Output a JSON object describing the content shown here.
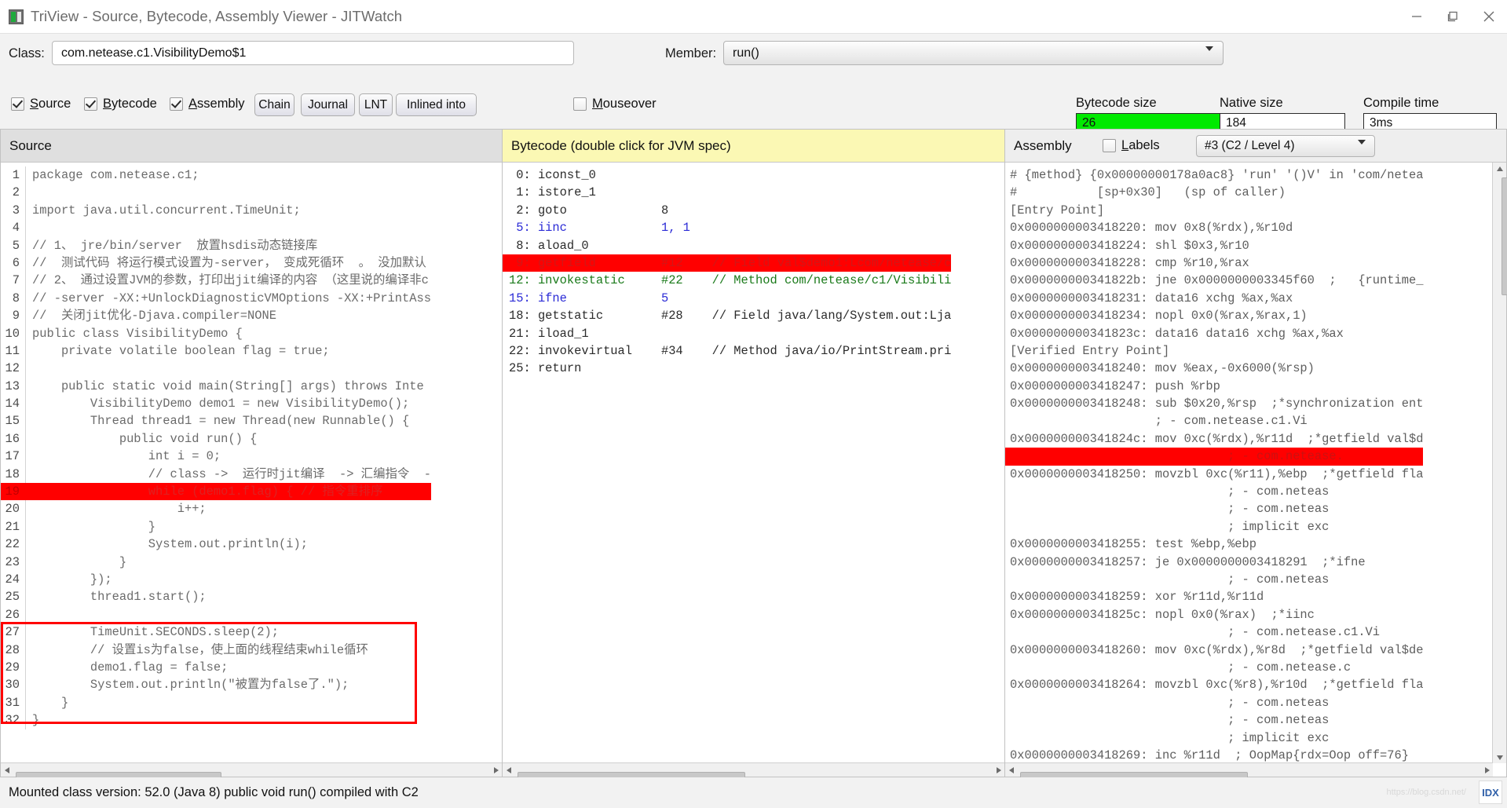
{
  "window": {
    "title": "TriView - Source, Bytecode, Assembly Viewer - JITWatch",
    "icon": "app-icon",
    "minimize_label": "–",
    "maximize_label": "❐",
    "close_label": "✕"
  },
  "toolbar": {
    "class_label": "Class:",
    "class_value": "com.netease.c1.VisibilityDemo$1",
    "member_label": "Member:",
    "member_value": "run()",
    "checkboxes": [
      {
        "label": "Source",
        "mnemonic": "S",
        "rest": "ource",
        "checked": true
      },
      {
        "label": "Bytecode",
        "mnemonic": "B",
        "rest": "ytecode",
        "checked": true
      },
      {
        "label": "Assembly",
        "mnemonic": "A",
        "rest": "ssembly",
        "checked": true
      },
      {
        "label": "Mouseover",
        "mnemonic": "M",
        "rest": "ouseover",
        "checked": false
      }
    ],
    "buttons": [
      "Chain",
      "Journal",
      "LNT",
      "Inlined into"
    ]
  },
  "metrics": [
    {
      "label": "Bytecode size",
      "value": "26",
      "highlight": "#00ea00"
    },
    {
      "label": "Native size",
      "value": "184",
      "highlight": ""
    },
    {
      "label": "Compile time",
      "value": "3ms",
      "highlight": ""
    }
  ],
  "source_panel": {
    "title": "Source",
    "lines": [
      {
        "n": "1",
        "text": "package com.netease.c1;",
        "hl": false
      },
      {
        "n": "2",
        "text": "",
        "hl": false
      },
      {
        "n": "3",
        "text": "import java.util.concurrent.TimeUnit;",
        "hl": false
      },
      {
        "n": "4",
        "text": "",
        "hl": false
      },
      {
        "n": "5",
        "text": "// 1、 jre/bin/server  放置hsdis动态链接库",
        "hl": false
      },
      {
        "n": "6",
        "text": "//  测试代码 将运行模式设置为-server， 变成死循环  。 没加默认",
        "hl": false
      },
      {
        "n": "7",
        "text": "// 2、 通过设置JVM的参数，打印出jit编译的内容 （这里说的编译非c",
        "hl": false
      },
      {
        "n": "8",
        "text": "// -server -XX:+UnlockDiagnosticVMOptions -XX:+PrintAss",
        "hl": false
      },
      {
        "n": "9",
        "text": "//  关闭jit优化-Djava.compiler=NONE",
        "hl": false
      },
      {
        "n": "10",
        "text": "public class VisibilityDemo {",
        "hl": false
      },
      {
        "n": "11",
        "text": "    private volatile boolean flag = true;",
        "hl": false
      },
      {
        "n": "12",
        "text": "",
        "hl": false
      },
      {
        "n": "13",
        "text": "    public static void main(String[] args) throws Inte",
        "hl": false
      },
      {
        "n": "14",
        "text": "        VisibilityDemo demo1 = new VisibilityDemo();",
        "hl": false
      },
      {
        "n": "15",
        "text": "        Thread thread1 = new Thread(new Runnable() {",
        "hl": false
      },
      {
        "n": "16",
        "text": "            public void run() {",
        "hl": false
      },
      {
        "n": "17",
        "text": "                int i = 0;",
        "hl": false
      },
      {
        "n": "18",
        "text": "                // class ->  运行时jit编译  -> 汇编指令  -",
        "hl": false
      },
      {
        "n": "19",
        "text": "                while (demo1.flag) { // 指令重排序",
        "hl": true
      },
      {
        "n": "20",
        "text": "                    i++;",
        "hl": false
      },
      {
        "n": "21",
        "text": "                }",
        "hl": false
      },
      {
        "n": "22",
        "text": "                System.out.println(i);",
        "hl": false
      },
      {
        "n": "23",
        "text": "            }",
        "hl": false
      },
      {
        "n": "24",
        "text": "        });",
        "hl": false
      },
      {
        "n": "25",
        "text": "        thread1.start();",
        "hl": false
      },
      {
        "n": "26",
        "text": "",
        "hl": false
      },
      {
        "n": "27",
        "text": "        TimeUnit.SECONDS.sleep(2);",
        "hl": false
      },
      {
        "n": "28",
        "text": "        // 设置is为false，使上面的线程结束while循环",
        "hl": false
      },
      {
        "n": "29",
        "text": "        demo1.flag = false;",
        "hl": false
      },
      {
        "n": "30",
        "text": "        System.out.println(\"被置为false了.\");",
        "hl": false
      },
      {
        "n": "31",
        "text": "    }",
        "hl": false
      },
      {
        "n": "32",
        "text": "}",
        "hl": false
      }
    ]
  },
  "bytecode_panel": {
    "title": "Bytecode (double click for JVM spec)",
    "lines": [
      {
        "offset": "0:",
        "op": "iconst_0",
        "arg": "",
        "comment": "",
        "color": "black",
        "hl": false
      },
      {
        "offset": "1:",
        "op": "istore_1",
        "arg": "",
        "comment": "",
        "color": "black",
        "hl": false
      },
      {
        "offset": "2:",
        "op": "goto",
        "arg": "8",
        "comment": "",
        "color": "black",
        "hl": false
      },
      {
        "offset": "5:",
        "op": "iinc",
        "arg": "1, 1",
        "comment": "",
        "color": "blue",
        "hl": false
      },
      {
        "offset": "8:",
        "op": "aload_0",
        "arg": "",
        "comment": "",
        "color": "black",
        "hl": false
      },
      {
        "offset": "9:",
        "op": "getfield",
        "arg": "#12",
        "comment": "// Field val$demo1:Lcom/netease/c",
        "color": "hl",
        "hl": true
      },
      {
        "offset": "12:",
        "op": "invokestatic",
        "arg": "#22",
        "comment": "// Method com/netease/c1/Visibili",
        "color": "green",
        "hl": false
      },
      {
        "offset": "15:",
        "op": "ifne",
        "arg": "5",
        "comment": "",
        "color": "blue",
        "hl": false
      },
      {
        "offset": "18:",
        "op": "getstatic",
        "arg": "#28",
        "comment": "// Field java/lang/System.out:Lja",
        "color": "black",
        "hl": false
      },
      {
        "offset": "21:",
        "op": "iload_1",
        "arg": "",
        "comment": "",
        "color": "black",
        "hl": false
      },
      {
        "offset": "22:",
        "op": "invokevirtual",
        "arg": "#34",
        "comment": "// Method java/io/PrintStream.pri",
        "color": "black",
        "hl": false
      },
      {
        "offset": "25:",
        "op": "return",
        "arg": "",
        "comment": "",
        "color": "black",
        "hl": false
      }
    ]
  },
  "assembly_panel": {
    "title": "Assembly",
    "labels_checkbox": {
      "label": "Labels",
      "mnemonic": "L",
      "rest": "abels",
      "checked": false
    },
    "level_value": "#3 (C2 / Level 4)",
    "lines": [
      {
        "text": "# {method} {0x00000000178a0ac8} 'run' '()V' in 'com/netea",
        "hl": false
      },
      {
        "text": "#           [sp+0x30]   (sp of caller)",
        "hl": false
      },
      {
        "text": "[Entry Point]",
        "hl": false
      },
      {
        "text": "0x0000000003418220: mov 0x8(%rdx),%r10d",
        "hl": false
      },
      {
        "text": "0x0000000003418224: shl $0x3,%r10",
        "hl": false
      },
      {
        "text": "0x0000000003418228: cmp %r10,%rax",
        "hl": false
      },
      {
        "text": "0x000000000341822b: jne 0x0000000003345f60  ;   {runtime_",
        "hl": false
      },
      {
        "text": "0x0000000003418231: data16 xchg %ax,%ax",
        "hl": false
      },
      {
        "text": "0x0000000003418234: nopl 0x0(%rax,%rax,1)",
        "hl": false
      },
      {
        "text": "0x000000000341823c: data16 data16 xchg %ax,%ax",
        "hl": false
      },
      {
        "text": "[Verified Entry Point]",
        "hl": false
      },
      {
        "text": "0x0000000003418240: mov %eax,-0x6000(%rsp)",
        "hl": false
      },
      {
        "text": "0x0000000003418247: push %rbp",
        "hl": false
      },
      {
        "text": "0x0000000003418248: sub $0x20,%rsp  ;*synchronization ent",
        "hl": false
      },
      {
        "text": "                    ; - com.netease.c1.Vi",
        "hl": false
      },
      {
        "text": "0x000000000341824c: mov 0xc(%rdx),%r11d  ;*getfield val$d",
        "hl": false
      },
      {
        "text": "                              ; - com.netease.",
        "hl": true
      },
      {
        "text": "0x0000000003418250: movzbl 0xc(%r11),%ebp  ;*getfield fla",
        "hl": false
      },
      {
        "text": "                              ; - com.neteas",
        "hl": false
      },
      {
        "text": "                              ; - com.neteas",
        "hl": false
      },
      {
        "text": "                              ; implicit exc",
        "hl": false
      },
      {
        "text": "0x0000000003418255: test %ebp,%ebp",
        "hl": false
      },
      {
        "text": "0x0000000003418257: je 0x0000000003418291  ;*ifne",
        "hl": false
      },
      {
        "text": "                              ; - com.neteas",
        "hl": false
      },
      {
        "text": "0x0000000003418259: xor %r11d,%r11d",
        "hl": false
      },
      {
        "text": "0x000000000341825c: nopl 0x0(%rax)  ;*iinc",
        "hl": false
      },
      {
        "text": "                              ; - com.netease.c1.Vi",
        "hl": false
      },
      {
        "text": "0x0000000003418260: mov 0xc(%rdx),%r8d  ;*getfield val$de",
        "hl": false
      },
      {
        "text": "                              ; - com.netease.c",
        "hl": false
      },
      {
        "text": "0x0000000003418264: movzbl 0xc(%r8),%r10d  ;*getfield fla",
        "hl": false
      },
      {
        "text": "                              ; - com.neteas",
        "hl": false
      },
      {
        "text": "                              ; - com.neteas",
        "hl": false
      },
      {
        "text": "                              ; implicit exc",
        "hl": false
      },
      {
        "text": "0x0000000003418269: inc %r11d  ; OopMap{rdx=Oop off=76}",
        "hl": false
      }
    ]
  },
  "statusbar": {
    "text": "Mounted class version: 52.0 (Java 8) public void run() compiled with C2",
    "watermark": "https://blog.csdn.net/",
    "watermark_badge": "IDX"
  }
}
